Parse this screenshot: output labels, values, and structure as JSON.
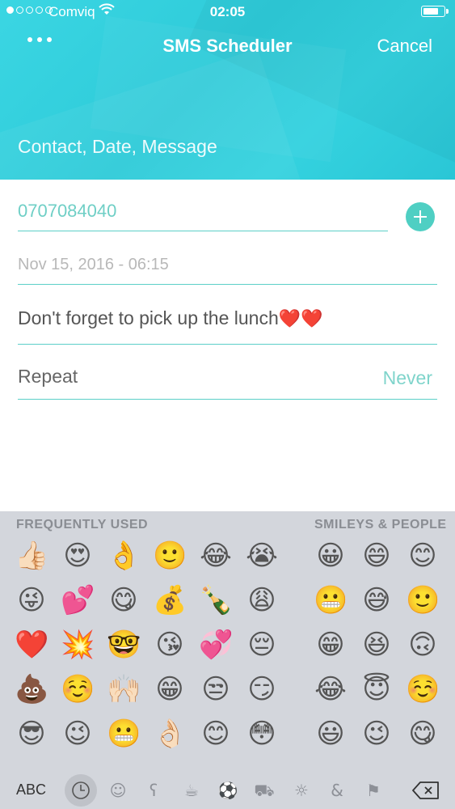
{
  "status_bar": {
    "carrier": "Comviq",
    "time": "02:05"
  },
  "nav": {
    "title": "SMS Scheduler",
    "cancel_label": "Cancel"
  },
  "header_subtitle": "Contact, Date, Message",
  "form": {
    "phone_value": "0707084040",
    "date_value": "Nov 15, 2016 - 06:15",
    "message_text": "Don't forget to pick up the lunch",
    "message_hearts": "❤️❤️",
    "repeat_label": "Repeat",
    "repeat_value": "Never"
  },
  "keyboard": {
    "frequently_used_label": "FREQUENTLY USED",
    "smileys_label": "SMILEYS & PEOPLE",
    "abc_label": "ABC",
    "emojis_left": [
      [
        "👍🏻",
        "😍",
        "👌",
        "🙂",
        "😂",
        "😭"
      ],
      [
        "😜",
        "💕",
        "😋",
        "💰",
        "🍾",
        "😩"
      ],
      [
        "❤️",
        "💥",
        "🤓",
        "😘",
        "💞",
        "😔"
      ],
      [
        "💩",
        "☺️",
        "🙌🏻",
        "😁",
        "😒",
        "😏"
      ],
      [
        "😎",
        "😉",
        "😬",
        "👌🏻",
        "😊",
        "😳"
      ]
    ],
    "emojis_right": [
      [
        "😀",
        "😄",
        "😊"
      ],
      [
        "😬",
        "😅",
        "🙂"
      ],
      [
        "😁",
        "😆",
        "🙃"
      ],
      [
        "😂",
        "😇",
        "☺️"
      ],
      [
        "😃",
        "😉",
        "😋"
      ]
    ],
    "category_icons": [
      "clock-icon",
      "smiley-icon",
      "bear-icon",
      "food-icon",
      "ball-icon",
      "car-icon",
      "bulb-icon",
      "symbols-icon",
      "flag-icon"
    ]
  },
  "colors": {
    "header": "#2ecbd9",
    "accent": "#4fcfc3",
    "keyboard_bg": "#d3d6dc"
  }
}
